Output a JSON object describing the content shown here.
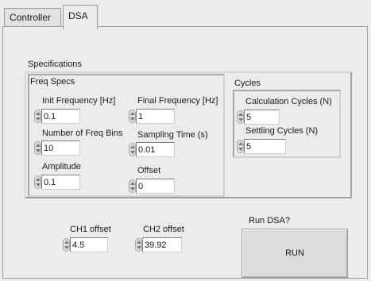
{
  "tabs": [
    {
      "label": "Controller",
      "active": false
    },
    {
      "label": "DSA",
      "active": true
    }
  ],
  "specifications": {
    "title": "Specifications",
    "freq_specs": {
      "title": "Freq Specs",
      "init_frequency": {
        "label": "Init Frequency [Hz]",
        "value": "0.1"
      },
      "final_frequency": {
        "label": "Final Frequency [Hz]",
        "value": "1"
      },
      "num_freq_bins": {
        "label": "Number of Freq Bins",
        "value": "10"
      },
      "sampling_time": {
        "label": "Sampling Time (s)",
        "value": "0.01"
      },
      "amplitude": {
        "label": "Amplitude",
        "value": "0.1"
      },
      "offset": {
        "label": "Offset",
        "value": "0"
      }
    },
    "cycles": {
      "title": "Cycles",
      "calculation_cycles": {
        "label": "Calculation Cycles (N)",
        "value": "5"
      },
      "settling_cycles": {
        "label": "Settling Cycles (N)",
        "value": "5"
      }
    }
  },
  "channels": {
    "ch1_offset": {
      "label": "CH1 offset",
      "value": "4.5"
    },
    "ch2_offset": {
      "label": "CH2 offset",
      "value": "39.92"
    }
  },
  "run": {
    "prompt": "Run DSA?",
    "button_label": "RUN"
  },
  "colors": {
    "background": "#ececec",
    "field": "#ffffff",
    "button": "#dcdcdc"
  },
  "icons": [
    "spinner-arrows-icon"
  ]
}
